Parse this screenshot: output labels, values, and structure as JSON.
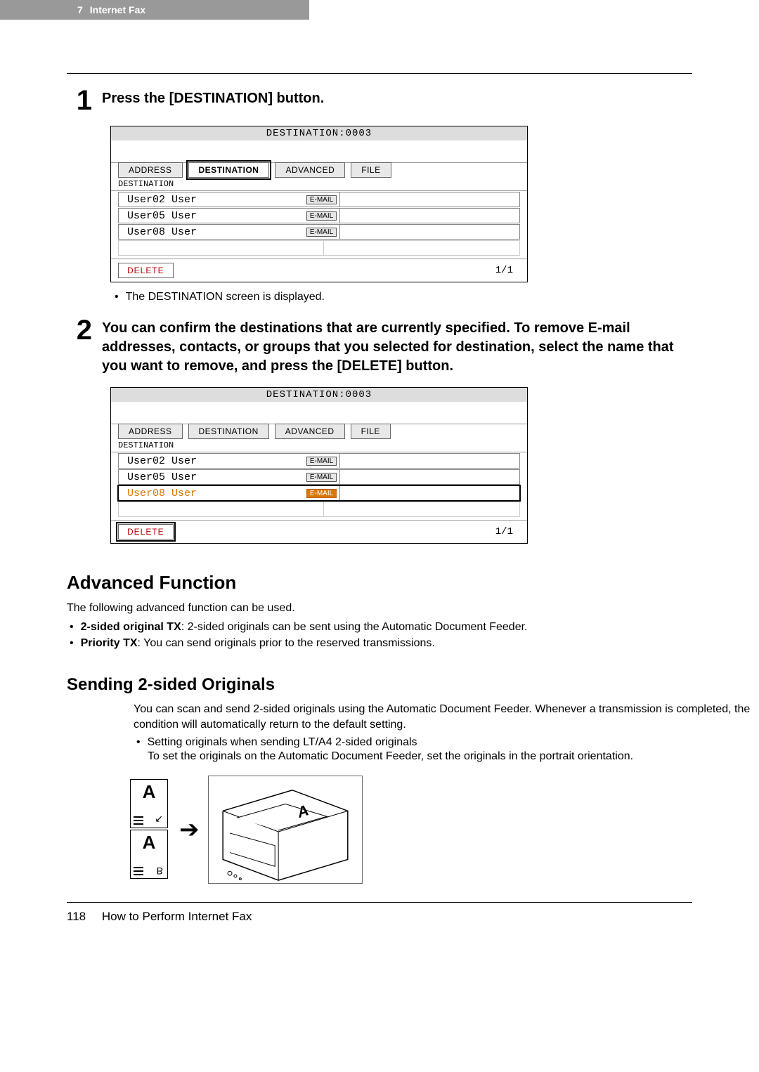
{
  "header": {
    "chapter_num": "7",
    "chapter_title": "Internet Fax"
  },
  "step1": {
    "num": "1",
    "heading": "Press the [DESTINATION] button.",
    "substep": "The DESTINATION screen is displayed."
  },
  "step2": {
    "num": "2",
    "heading": "You can confirm the destinations that are currently specified. To remove E-mail addresses, contacts, or groups that you selected for destination, select the name that you want to remove, and press the [DELETE] button."
  },
  "screen": {
    "title": "DESTINATION:0003",
    "tabs": [
      "ADDRESS",
      "DESTINATION",
      "ADVANCED",
      "FILE"
    ],
    "section_label": "DESTINATION",
    "rows": [
      {
        "name": "User02 User",
        "badge": "E-MAIL"
      },
      {
        "name": "User05 User",
        "badge": "E-MAIL"
      },
      {
        "name": "User08 User",
        "badge": "E-MAIL"
      }
    ],
    "delete_label": "DELETE",
    "page": "1/1"
  },
  "advanced": {
    "heading": "Advanced Function",
    "intro": "The following advanced function can be used.",
    "items": [
      {
        "term": "2-sided original TX",
        "desc": ": 2-sided originals can be sent using the Automatic Document Feeder."
      },
      {
        "term": "Priority TX",
        "desc": ": You can send originals prior to the reserved transmissions."
      }
    ]
  },
  "sending": {
    "heading": "Sending 2-sided Originals",
    "para": "You can scan and send 2-sided originals using the Automatic Document Feeder. Whenever a transmission is completed, the condition will automatically return to the default setting.",
    "bullet": "Setting originals when sending LT/A4 2-sided originals",
    "bullet_desc": "To set the originals on the Automatic Document Feeder, set the originals in the portrait orientation."
  },
  "diagram": {
    "page_front": "A",
    "page_back_top": "A",
    "page_back_bottom": "B",
    "feeder_page": "A"
  },
  "footer": {
    "page_num": "118",
    "title": "How to Perform Internet Fax"
  }
}
